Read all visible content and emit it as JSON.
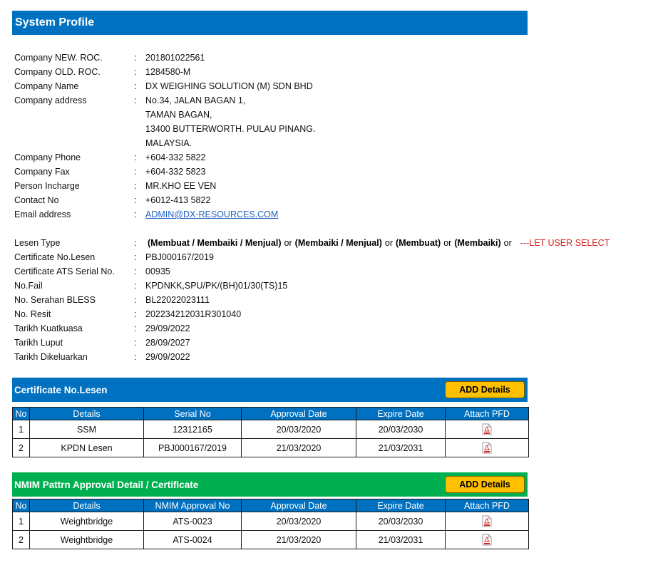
{
  "title": "System Profile",
  "profile": {
    "company_new_roc": {
      "label": "Company NEW. ROC.",
      "value": "201801022561"
    },
    "company_old_roc": {
      "label": "Company OLD. ROC.",
      "value": "1284580-M"
    },
    "company_name": {
      "label": "Company Name",
      "value": "DX WEIGHING SOLUTION (M) SDN BHD"
    },
    "company_address": {
      "label": "Company address",
      "lines": [
        "No.34, JALAN BAGAN 1,",
        "TAMAN BAGAN,",
        "13400 BUTTERWORTH. PULAU PINANG.",
        "MALAYSIA."
      ]
    },
    "company_phone": {
      "label": "Company Phone",
      "value": "+604-332 5822"
    },
    "company_fax": {
      "label": "Company Fax",
      "value": "+604-332 5823"
    },
    "person_incharge": {
      "label": "Person Incharge",
      "value": "MR.KHO EE VEN"
    },
    "contact_no": {
      "label": "Contact No",
      "value": "+6012-413 5822"
    },
    "email": {
      "label": "Email address",
      "value": "ADMIN@DX-RESOURCES.COM"
    },
    "lesen_type": {
      "label": "Lesen Type",
      "options": [
        "(Membuat / Membaiki / Menjual)",
        "(Membaiki / Menjual)",
        "(Membuat)",
        "(Membaiki)"
      ],
      "separator": "or",
      "note": "---LET USER SELECT"
    },
    "cert_no_lesen": {
      "label": "Certificate No.Lesen",
      "value": "PBJ000167/2019"
    },
    "cert_ats_serial": {
      "label": "Certificate ATS Serial No.",
      "value": "00935"
    },
    "no_fail": {
      "label": "No.Fail",
      "value": "KPDNKK,SPU/PK/(BH)01/30(TS)15"
    },
    "no_serahan": {
      "label": "No. Serahan BLESS",
      "value": "BL22022023111"
    },
    "no_resit": {
      "label": "No. Resit",
      "value": "202234212031R301040"
    },
    "tarikh_kuatkuasa": {
      "label": "Tarikh Kuatkuasa",
      "value": "29/09/2022"
    },
    "tarikh_luput": {
      "label": "Tarikh Luput",
      "value": "28/09/2027"
    },
    "tarikh_dikeluarkan": {
      "label": "Tarikh Dikeluarkan",
      "value": "29/09/2022"
    },
    "colon": ":"
  },
  "cert_section": {
    "title": "Certificate No.Lesen",
    "add_label": "ADD Details",
    "headers": [
      "No",
      "Details",
      "Serial No",
      "Approval Date",
      "Expire Date",
      "Attach PFD"
    ],
    "rows": [
      {
        "no": "1",
        "details": "SSM",
        "serial": "12312165",
        "approval": "20/03/2020",
        "expire": "20/03/2030",
        "attach_icon": "pdf-icon"
      },
      {
        "no": "2",
        "details": "KPDN Lesen",
        "serial": "PBJ000167/2019",
        "approval": "21/03/2020",
        "expire": "21/03/2031",
        "attach_icon": "pdf-icon"
      }
    ]
  },
  "nmim_section": {
    "title": "NMIM Pattrn Approval Detail / Certificate",
    "add_label": "ADD Details",
    "headers": [
      "No",
      "Details",
      "NMIM Approval No",
      "Approval Date",
      "Expire Date",
      "Attach PFD"
    ],
    "rows": [
      {
        "no": "1",
        "details": "Weightbridge",
        "serial": "ATS-0023",
        "approval": "20/03/2020",
        "expire": "20/03/2030",
        "attach_icon": "pdf-icon"
      },
      {
        "no": "2",
        "details": "Weightbridge",
        "serial": "ATS-0024",
        "approval": "21/03/2020",
        "expire": "21/03/2031",
        "attach_icon": "pdf-icon"
      }
    ]
  },
  "colors": {
    "header_blue": "#0070c0",
    "header_green": "#00b050",
    "button_yellow": "#ffc000",
    "note_red": "#d9231f",
    "link_blue": "#1f5fbf"
  }
}
